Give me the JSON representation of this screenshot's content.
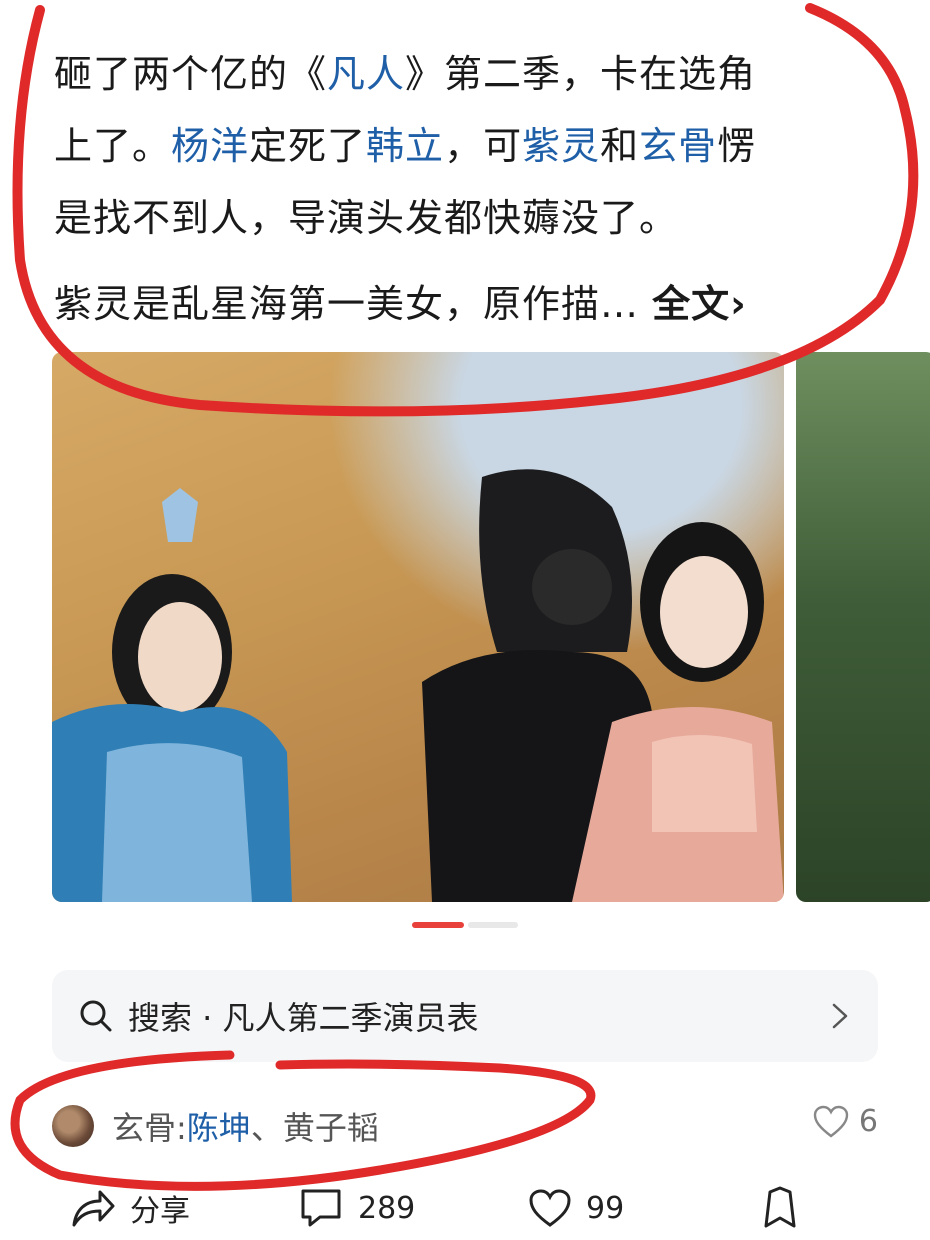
{
  "post": {
    "line1": "砸了两个亿的《",
    "link_fanren": "凡人",
    "line1_after": "》第二季，卡在选角",
    "line2_pre": "上了。",
    "link_yangyang": "杨洋",
    "line2_mid": "定死了",
    "link_hanli": "韩立",
    "line2_mid2": "，可",
    "link_ziling": "紫灵",
    "line2_and": "和",
    "link_xuangu": "玄骨",
    "line2_end": "愣",
    "line3": "是找不到人，导演头发都快薅没了。",
    "para2": "紫灵是乱星海第一美女，原作描… ",
    "full_text": "全文",
    "full_text_arrow": "›"
  },
  "carousel": {
    "active_index": 0,
    "total": 2
  },
  "search": {
    "label": "搜索 · 凡人第二季演员表"
  },
  "comment": {
    "prefix": "玄骨:",
    "actor1": "陈坤",
    "separator": "、",
    "actor2": "黄子韬",
    "likes": "6"
  },
  "actions": {
    "share": "分享",
    "comments": "289",
    "likes": "99"
  },
  "colors": {
    "link": "#1f5fa8",
    "accent": "#e8403a",
    "annotation": "#e02a2a"
  }
}
